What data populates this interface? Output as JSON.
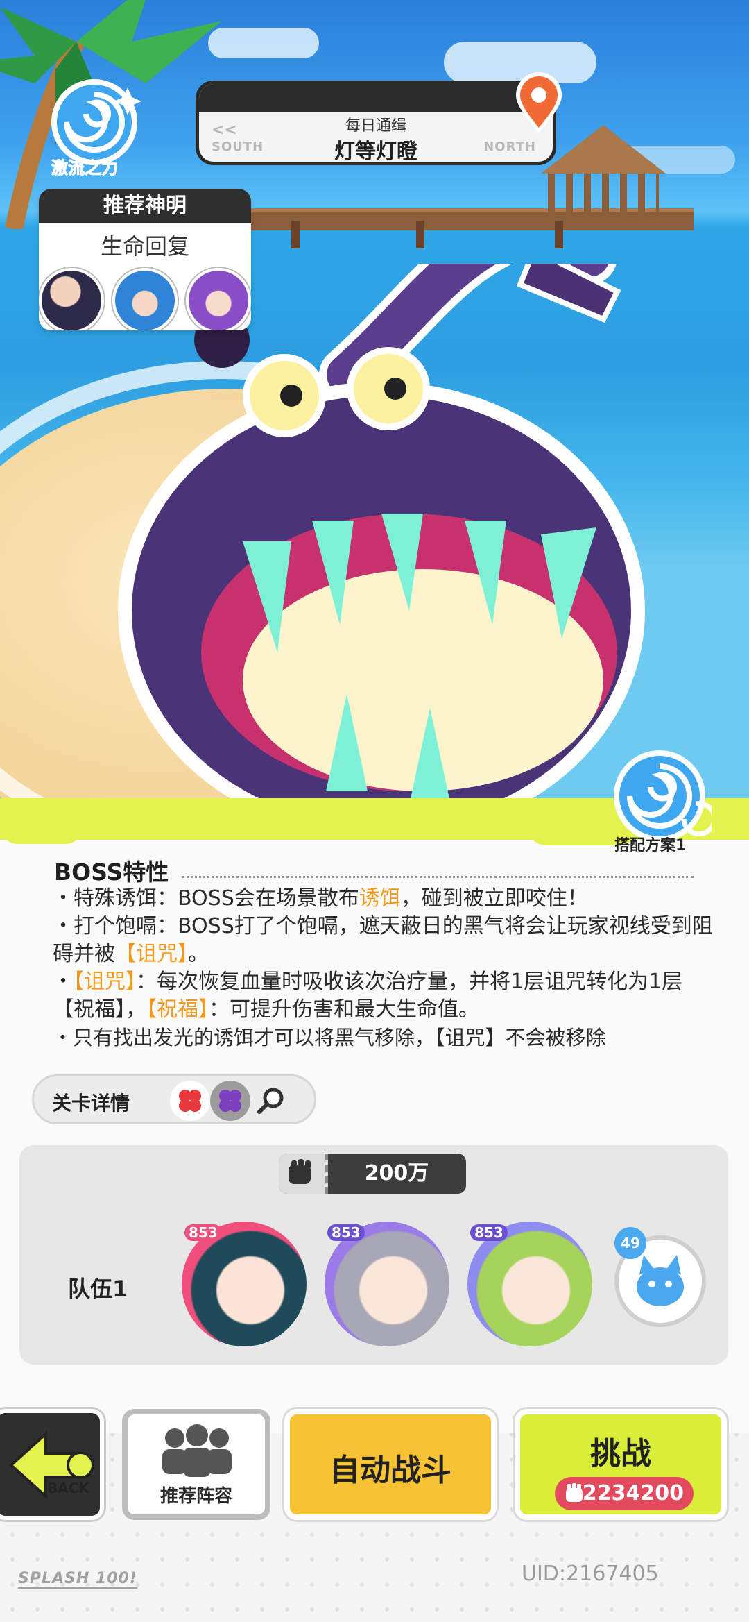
{
  "element": {
    "name": "激流之力"
  },
  "daily": {
    "subtitle": "每日通缉",
    "title": "灯等灯瞪",
    "left_arrows": "<<",
    "left_dir": "SOUTH",
    "right_dir": "NORTH"
  },
  "recommend": {
    "header": "推荐神明",
    "effect": "生命回复",
    "avatars": [
      "avatar-1",
      "avatar-2",
      "avatar-3"
    ]
  },
  "plan": {
    "label": "搭配方案1"
  },
  "boss": {
    "title": "BOSS特性",
    "traits": [
      {
        "a": "・特殊诱饵：BOSS会在场景散布",
        "h": "诱饵",
        "b": "，碰到被立即咬住！"
      },
      {
        "a": "・打个饱嗝：BOSS打了个饱嗝，遮天蔽日的黑气将会让玩家视线受到阻碍并被",
        "h": "【诅咒】",
        "b": "。"
      },
      {
        "a": "・",
        "h": "【诅咒】",
        "b": "：每次恢复血量时吸收该次治疗量，并将1层诅咒转化为1层【祝福】，",
        "h2": "【祝福】",
        "c": "：可提升伤害和最大生命值。"
      },
      {
        "a": "・只有找出发光的诱饵才可以将黑气移除，【诅咒】不会被移除",
        "h": "",
        "b": ""
      }
    ]
  },
  "details": {
    "label": "关卡详情"
  },
  "team": {
    "label": "队伍1",
    "power": "200万",
    "members": [
      {
        "level": "853",
        "color": "#ef4f7a"
      },
      {
        "level": "853",
        "color": "#9a7be8"
      },
      {
        "level": "853",
        "color": "#8f8cef"
      }
    ],
    "pet_level": "49"
  },
  "actions": {
    "back": "BACK",
    "recommend": "推荐阵容",
    "auto": "自动战斗",
    "fight": "挑战",
    "fight_power": "2234200"
  },
  "footer": {
    "logo": "SPLASH 100!",
    "uid": "UID:2167405"
  }
}
